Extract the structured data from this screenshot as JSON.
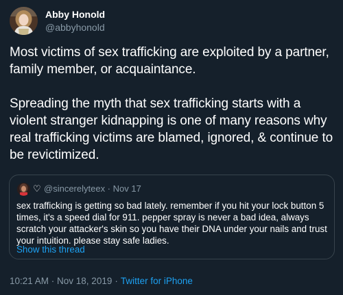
{
  "author": {
    "name": "Abby Honold",
    "handle": "@abbyhonold"
  },
  "tweet": {
    "paragraph1": "Most victims of sex trafficking are exploited by a partner, family member, or acquaintance.",
    "paragraph2": "Spreading the myth that sex trafficking starts with a violent stranger kidnapping is one of many reasons why real trafficking victims are blamed, ignored, & continue to be revictimized."
  },
  "quoted_tweet": {
    "heart_glyph": "♡",
    "handle": "@sincerelyteex · Nov 17",
    "text": "sex trafficking is getting so bad lately. remember if you hit your lock button 5 times, it's a speed dial for 911. pepper spray is never a bad idea, always scratch your attacker's skin so you have their DNA under your nails and trust your intuition. please stay safe ladies.",
    "show_thread": "Show this thread"
  },
  "meta": {
    "timestamp": "10:21 AM · Nov 18, 2019",
    "separator": "·",
    "source": "Twitter for iPhone"
  },
  "colors": {
    "background": "#15202b",
    "secondary_text": "#8899a6",
    "link": "#1da1f2",
    "border": "#38444d"
  }
}
